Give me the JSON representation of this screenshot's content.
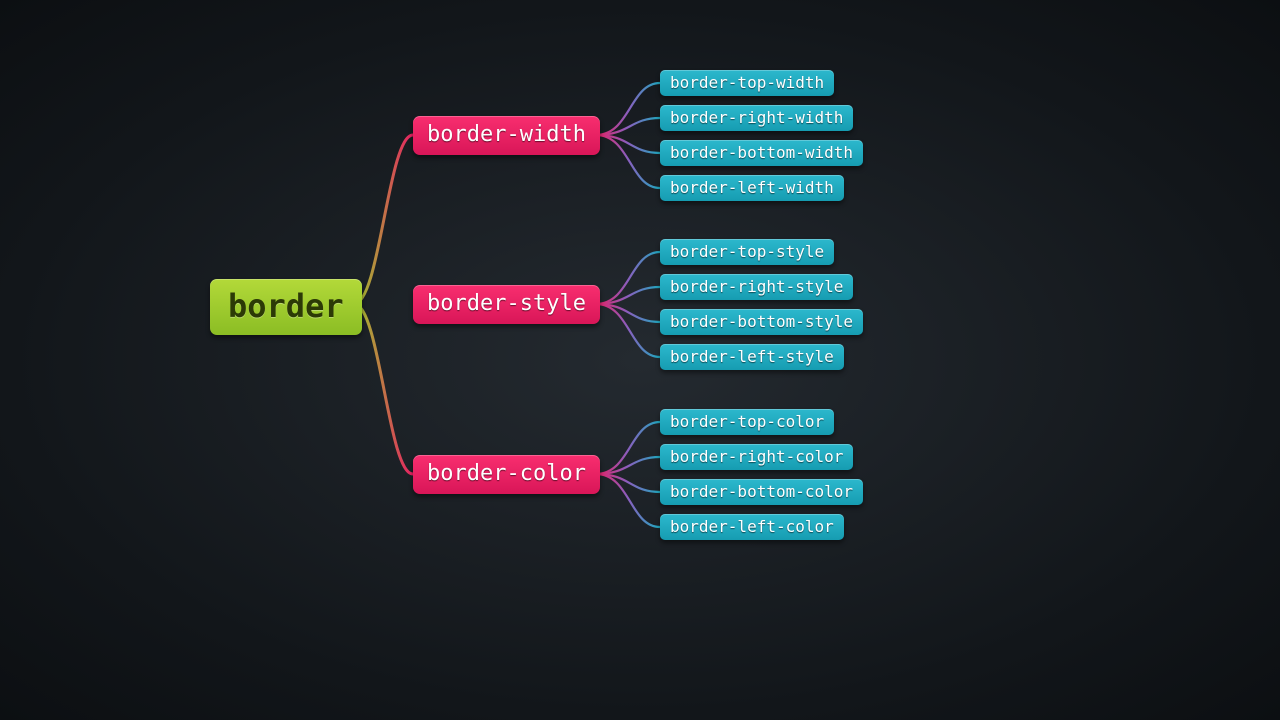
{
  "root": {
    "label": "border"
  },
  "mid": [
    {
      "id": "width",
      "label": "border-width"
    },
    {
      "id": "style",
      "label": "border-style"
    },
    {
      "id": "color",
      "label": "border-color"
    }
  ],
  "leaves": {
    "width": [
      "border-top-width",
      "border-right-width",
      "border-bottom-width",
      "border-left-width"
    ],
    "style": [
      "border-top-style",
      "border-right-style",
      "border-bottom-style",
      "border-left-style"
    ],
    "color": [
      "border-top-color",
      "border-right-color",
      "border-bottom-color",
      "border-left-color"
    ]
  },
  "colors": {
    "root": "#9bc82b",
    "mid": "#e81f63",
    "leaf": "#1ea9bf"
  }
}
